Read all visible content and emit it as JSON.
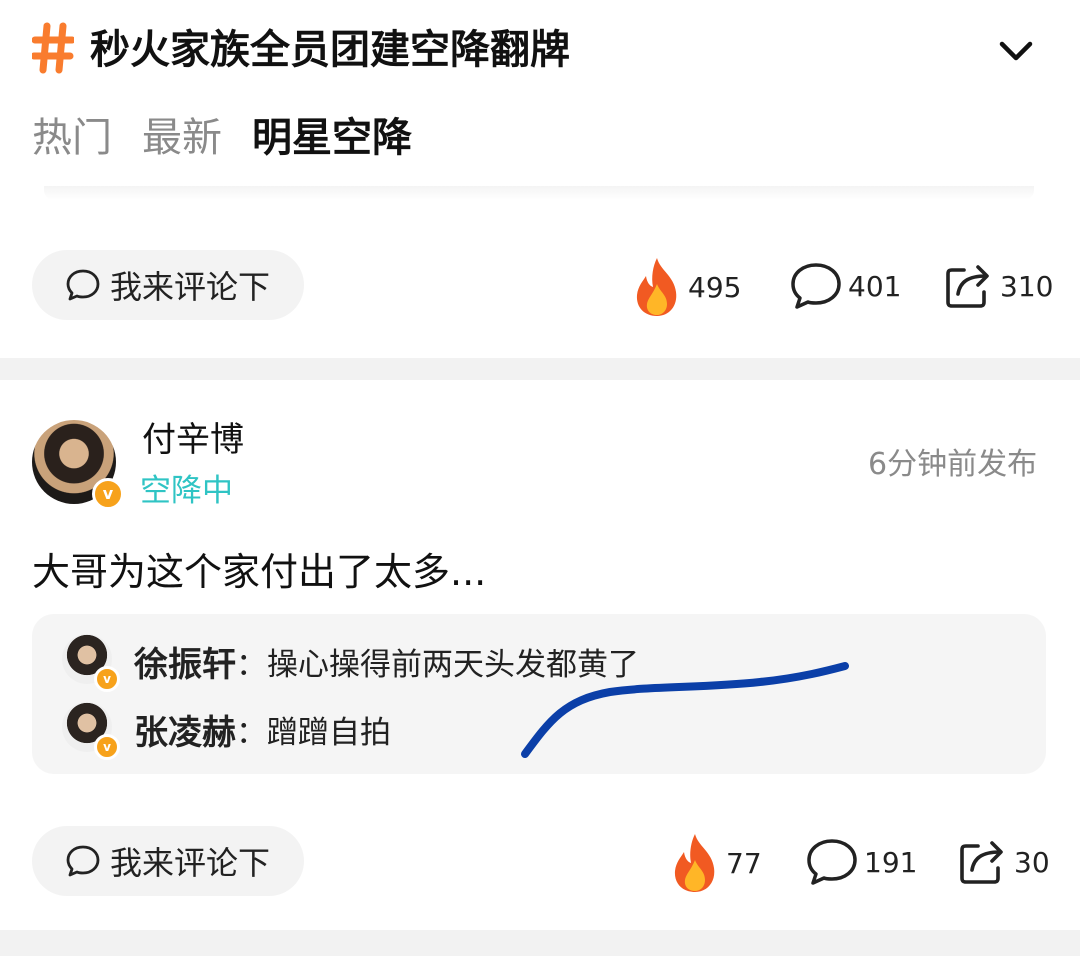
{
  "header": {
    "title": "秒火家族全员团建空降翻牌",
    "hash_color": "#f97c2e"
  },
  "tabs": [
    {
      "label": "热门",
      "active": false
    },
    {
      "label": "最新",
      "active": false
    },
    {
      "label": "明星空降",
      "active": true
    }
  ],
  "top_bar": {
    "comment_placeholder": "我来评论下",
    "likes": "495",
    "comments": "401",
    "shares": "310"
  },
  "post": {
    "author": "付辛博",
    "status": "空降中",
    "time": "6分钟前发布",
    "text": "大哥为这个家付出了太多...",
    "replies": [
      {
        "name": "徐振轩",
        "sep": "：",
        "text": "操心操得前两天头发都黄了"
      },
      {
        "name": "张凌赫",
        "sep": "：",
        "text": "蹭蹭自拍"
      }
    ],
    "comment_placeholder": "我来评论下",
    "likes": "77",
    "comments": "191",
    "shares": "30"
  },
  "colors": {
    "status_teal": "#2fc4c4",
    "badge_orange": "#f7a21b",
    "scribble_blue": "#0b3fa8"
  }
}
